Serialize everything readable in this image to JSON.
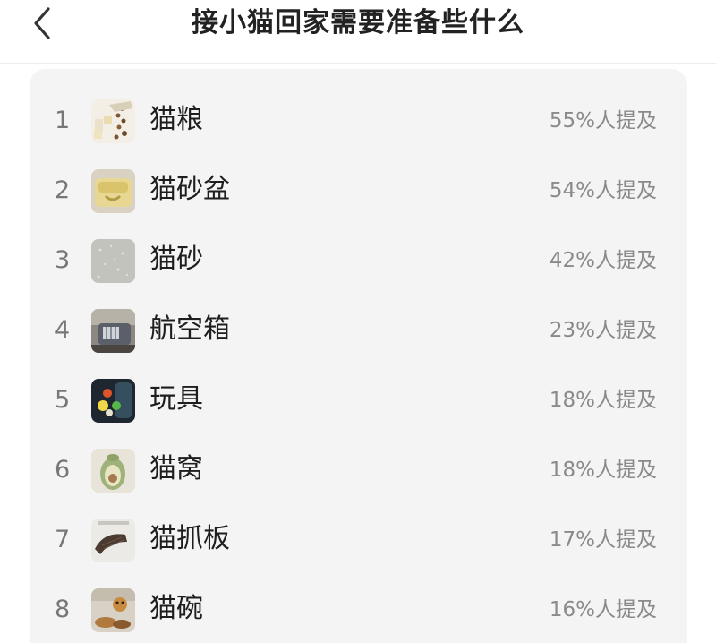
{
  "header": {
    "title": "接小猫回家需要准备些什么"
  },
  "list": {
    "items": [
      {
        "rank": "1",
        "name": "猫粮",
        "mention": "55%人提及",
        "thumb": "cat-food-photo"
      },
      {
        "rank": "2",
        "name": "猫砂盆",
        "mention": "54%人提及",
        "thumb": "litter-box-photo"
      },
      {
        "rank": "3",
        "name": "猫砂",
        "mention": "42%人提及",
        "thumb": "cat-litter-photo"
      },
      {
        "rank": "4",
        "name": "航空箱",
        "mention": "23%人提及",
        "thumb": "pet-carrier-photo"
      },
      {
        "rank": "5",
        "name": "玩具",
        "mention": "18%人提及",
        "thumb": "cat-toy-photo"
      },
      {
        "rank": "6",
        "name": "猫窝",
        "mention": "18%人提及",
        "thumb": "cat-bed-photo"
      },
      {
        "rank": "7",
        "name": "猫抓板",
        "mention": "17%人提及",
        "thumb": "scratch-board-photo"
      },
      {
        "rank": "8",
        "name": "猫碗",
        "mention": "16%人提及",
        "thumb": "cat-bowl-photo"
      }
    ]
  },
  "colors": {
    "card_background": "#f4f4f4",
    "title_text": "#222222",
    "item_text": "#1e1e1e",
    "secondary_text": "#8a8a8a"
  }
}
